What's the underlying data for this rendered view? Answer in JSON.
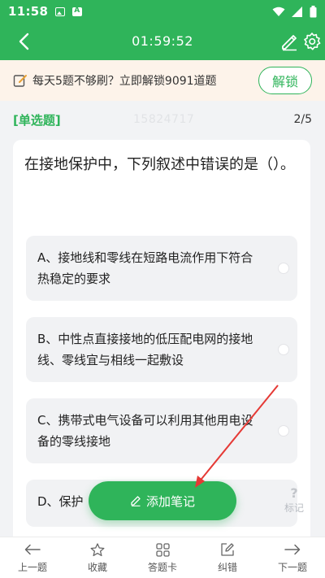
{
  "status_bar": {
    "time": "11:58"
  },
  "header": {
    "timer": "01:59:52"
  },
  "promo": {
    "text": "每天5题不够刷？立即解锁9091道题",
    "button": "解锁"
  },
  "meta": {
    "question_type": "[单选题]",
    "watermark_id": "15824717",
    "progress": "2/5"
  },
  "question": {
    "text": "在接地保护中，下列叙述中错误的是（）。",
    "options": [
      {
        "label": "A、接地线和零线在短路电流作用下符合热稳定的要求"
      },
      {
        "label": "B、中性点直接接地的低压配电网的接地线、零线宜与相线一起敷设"
      },
      {
        "label": "C、携带式电气设备可以利用其他用电设备的零线接地"
      },
      {
        "label": "D、保护"
      }
    ]
  },
  "fab": {
    "label": "添加笔记"
  },
  "mark": {
    "label": "标记",
    "glyph": "?"
  },
  "bottom_nav": [
    {
      "label": "上一题",
      "icon": "arrow-left-icon"
    },
    {
      "label": "收藏",
      "icon": "star-icon"
    },
    {
      "label": "答题卡",
      "icon": "grid-icon"
    },
    {
      "label": "纠错",
      "icon": "edit-square-icon"
    },
    {
      "label": "下一题",
      "icon": "arrow-right-icon"
    }
  ],
  "colors": {
    "primary": "#2fb45a",
    "promo_bg": "#fdf3ea",
    "arrow": "#e53935"
  }
}
